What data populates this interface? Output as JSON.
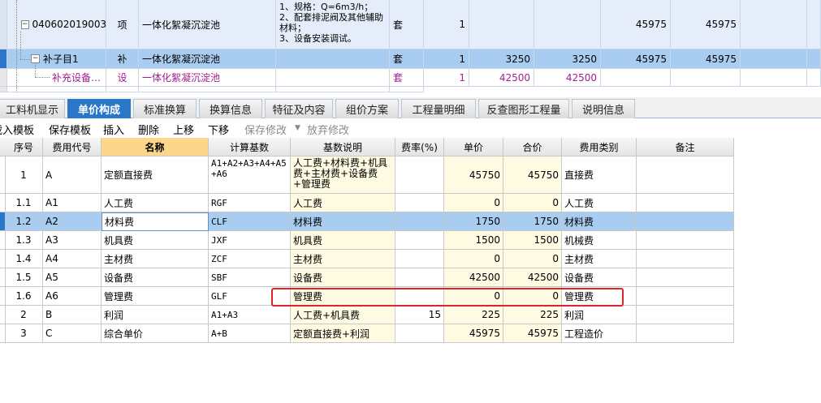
{
  "top_grid": {
    "rows": [
      {
        "code": "040602019003",
        "type": "项",
        "name": "一体化絮凝沉淀池",
        "desc": "1、规格：Q=6m3/h；\n2、配套排泥阀及其他辅助材料；\n3、设备安装调试。",
        "unit": "套",
        "qty": "1",
        "price1": "",
        "price2": "",
        "total1": "45975",
        "total2": "45975",
        "expand": "−"
      },
      {
        "code": "补子目1",
        "type": "补",
        "name": "一体化絮凝沉淀池",
        "desc": "",
        "unit": "套",
        "qty": "1",
        "price1": "3250",
        "price2": "3250",
        "total1": "45975",
        "total2": "45975",
        "expand": "−"
      },
      {
        "code": "补充设备…",
        "type": "设",
        "name": "一体化絮凝沉淀池",
        "desc": "",
        "unit": "套",
        "qty": "1",
        "price1": "42500",
        "price2": "42500",
        "total1": "",
        "total2": ""
      }
    ]
  },
  "tabs": [
    "工料机显示",
    "单价构成",
    "标准换算",
    "换算信息",
    "特征及内容",
    "组价方案",
    "工程量明细",
    "反查图形工程量",
    "说明信息"
  ],
  "active_tab": "单价构成",
  "toolbar": {
    "load_template": "载入模板",
    "save_template": "保存模板",
    "insert": "插入",
    "delete": "删除",
    "move_up": "上移",
    "move_down": "下移",
    "save_changes": "保存修改",
    "discard_changes": "放弃修改"
  },
  "fee_grid": {
    "headers": [
      "序号",
      "费用代号",
      "名称",
      "计算基数",
      "基数说明",
      "费率(%)",
      "单价",
      "合价",
      "费用类别",
      "备注"
    ],
    "rows": [
      {
        "seq": "1",
        "code": "A",
        "name": "定额直接费",
        "base": "A1+A2+A3+A4+A5+A6",
        "base_desc": "人工费+材料费+机具费+主材费+设备费+管理费",
        "rate": "",
        "price": "45750",
        "total": "45750",
        "category": "直接费",
        "note": ""
      },
      {
        "seq": "1.1",
        "code": "A1",
        "name": "人工费",
        "base": "RGF",
        "base_desc": "人工费",
        "rate": "",
        "price": "0",
        "total": "0",
        "category": "人工费",
        "note": ""
      },
      {
        "seq": "1.2",
        "code": "A2",
        "name": "材料费",
        "base": "CLF",
        "base_desc": "材料费",
        "rate": "",
        "price": "1750",
        "total": "1750",
        "category": "材料费",
        "note": ""
      },
      {
        "seq": "1.3",
        "code": "A3",
        "name": "机具费",
        "base": "JXF",
        "base_desc": "机具费",
        "rate": "",
        "price": "1500",
        "total": "1500",
        "category": "机械费",
        "note": ""
      },
      {
        "seq": "1.4",
        "code": "A4",
        "name": "主材费",
        "base": "ZCF",
        "base_desc": "主材费",
        "rate": "",
        "price": "0",
        "total": "0",
        "category": "主材费",
        "note": ""
      },
      {
        "seq": "1.5",
        "code": "A5",
        "name": "设备费",
        "base": "SBF",
        "base_desc": "设备费",
        "rate": "",
        "price": "42500",
        "total": "42500",
        "category": "设备费",
        "note": ""
      },
      {
        "seq": "1.6",
        "code": "A6",
        "name": "管理费",
        "base": "GLF",
        "base_desc": "管理费",
        "rate": "",
        "price": "0",
        "total": "0",
        "category": "管理费",
        "note": ""
      },
      {
        "seq": "2",
        "code": "B",
        "name": "利润",
        "base": "A1+A3",
        "base_desc": "人工费+机具费",
        "rate": "15",
        "price": "225",
        "total": "225",
        "category": "利润",
        "note": ""
      },
      {
        "seq": "3",
        "code": "C",
        "name": "综合单价",
        "base": "A+B",
        "base_desc": "定额直接费+利润",
        "rate": "",
        "price": "45975",
        "total": "45975",
        "category": "工程造价",
        "note": ""
      }
    ],
    "selected_row": "1.2"
  },
  "colors": {
    "accent": "#2a77c9",
    "selection": "#a9cdf0",
    "highlight_box": "#e0242c"
  }
}
